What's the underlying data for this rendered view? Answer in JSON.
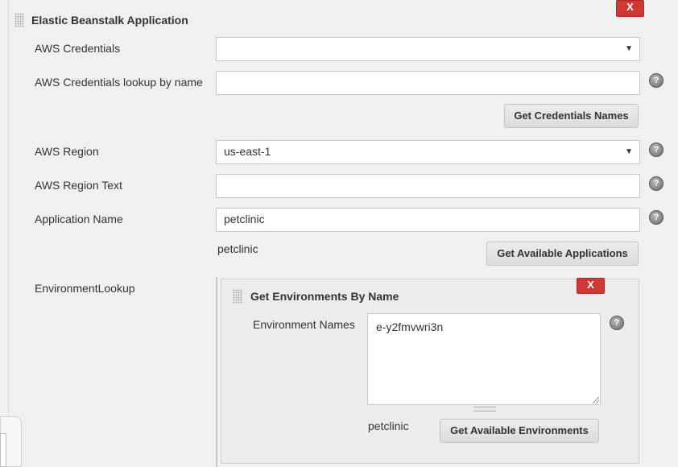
{
  "section": {
    "title": "Elastic Beanstalk Application",
    "delete_label": "X"
  },
  "credentials": {
    "label": "AWS Credentials",
    "value": ""
  },
  "credentials_lookup": {
    "label": "AWS Credentials lookup by name",
    "value": "",
    "button": "Get Credentials Names"
  },
  "region": {
    "label": "AWS Region",
    "value": "us-east-1"
  },
  "region_text": {
    "label": "AWS Region Text",
    "value": ""
  },
  "application": {
    "label": "Application Name",
    "value": "petclinic",
    "resolved": "petclinic",
    "button": "Get Available Applications"
  },
  "environment_lookup": {
    "label": "EnvironmentLookup",
    "panel_title": "Get Environments By Name",
    "delete_label": "X",
    "names_label": "Environment Names",
    "names_value": "e-y2fmvwri3n",
    "resolved": "petclinic",
    "button": "Get Available Environments"
  },
  "icons": {
    "help": "help-icon",
    "dropdown": "chevron-down-icon",
    "drag": "drag-handle-icon"
  },
  "colors": {
    "delete": "#cc3a33",
    "background": "#f0f0f0"
  }
}
